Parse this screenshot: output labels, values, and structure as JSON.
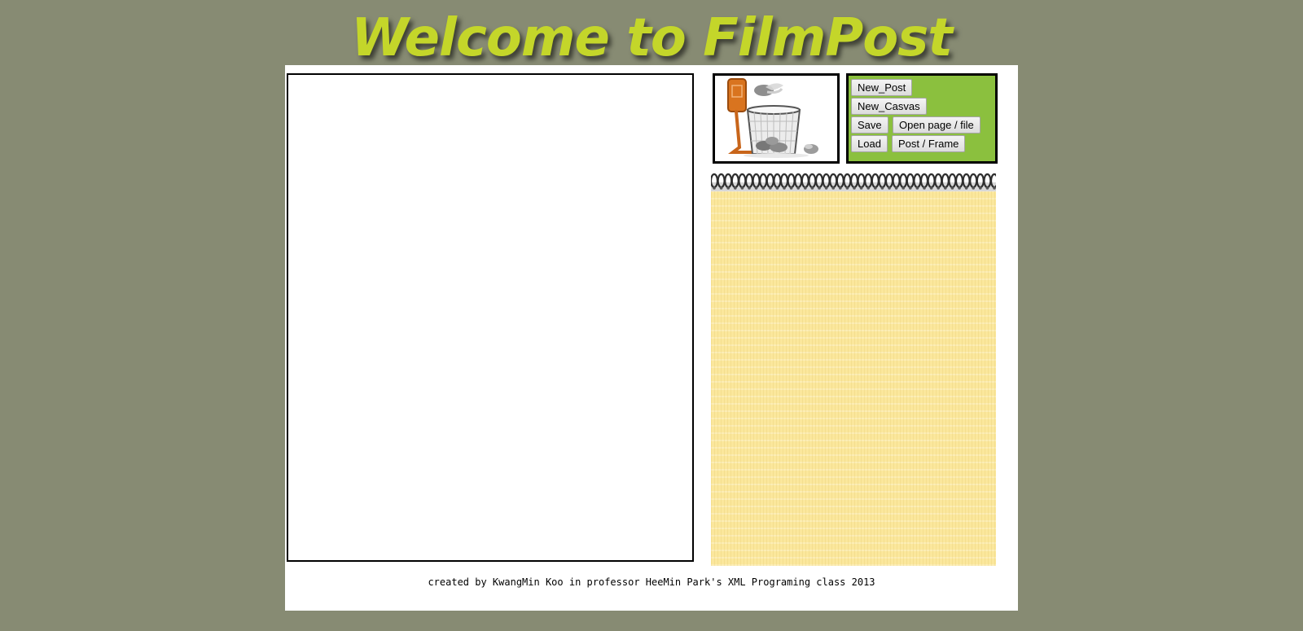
{
  "header": {
    "title": "Welcome to FilmPost"
  },
  "toolbar": {
    "new_post": "New_Post",
    "new_canvas": "New_Casvas",
    "save": "Save",
    "open_page_file": "Open page / file",
    "load": "Load",
    "post_frame": "Post / Frame"
  },
  "footer": {
    "credit": "created by KwangMin Koo in professor HeeMin Park's XML Programing class 2013"
  },
  "colors": {
    "background": "#878b73",
    "title": "#c4d62a",
    "controls_panel": "#8bc03e",
    "notepad_paper": "#fbe79c"
  },
  "icons": {
    "trash": "trash-basketball-hoop-icon",
    "spiral": "spiral-binding"
  }
}
